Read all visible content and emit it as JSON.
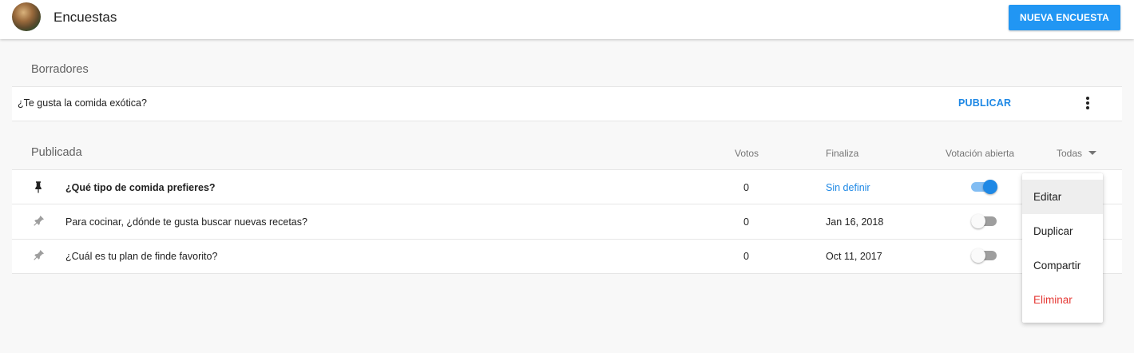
{
  "header": {
    "title": "Encuestas",
    "new_button": "NUEVA ENCUESTA"
  },
  "drafts": {
    "title": "Borradores",
    "items": [
      {
        "question": "¿Te gusta la comida exótica?",
        "action": "PUBLICAR",
        "menu_icon": "more-vert-icon"
      }
    ]
  },
  "published": {
    "title": "Publicada",
    "columns": {
      "votes": "Votos",
      "ends": "Finaliza",
      "open": "Votación abierta"
    },
    "filter": {
      "selected": "Todas"
    },
    "rows": [
      {
        "pinned": true,
        "question": "¿Qué tipo de comida prefieres?",
        "votes": "0",
        "ends": "Sin definir",
        "open_voting": true
      },
      {
        "pinned": false,
        "question": "Para cocinar, ¿dónde te gusta buscar nuevas recetas?",
        "votes": "0",
        "ends": "Jan 16, 2018",
        "open_voting": false
      },
      {
        "pinned": false,
        "question": "¿Cuál es tu plan de finde favorito?",
        "votes": "0",
        "ends": "Oct 11, 2017",
        "open_voting": false
      }
    ]
  },
  "context_menu": {
    "items": [
      {
        "label": "Editar"
      },
      {
        "label": "Duplicar"
      },
      {
        "label": "Compartir"
      },
      {
        "label": "Eliminar"
      }
    ]
  },
  "colors": {
    "accent": "#2196f3",
    "link": "#1e88e5",
    "danger": "#e53935",
    "pin_active": "#212121",
    "pin_inactive": "#9e9e9e"
  }
}
